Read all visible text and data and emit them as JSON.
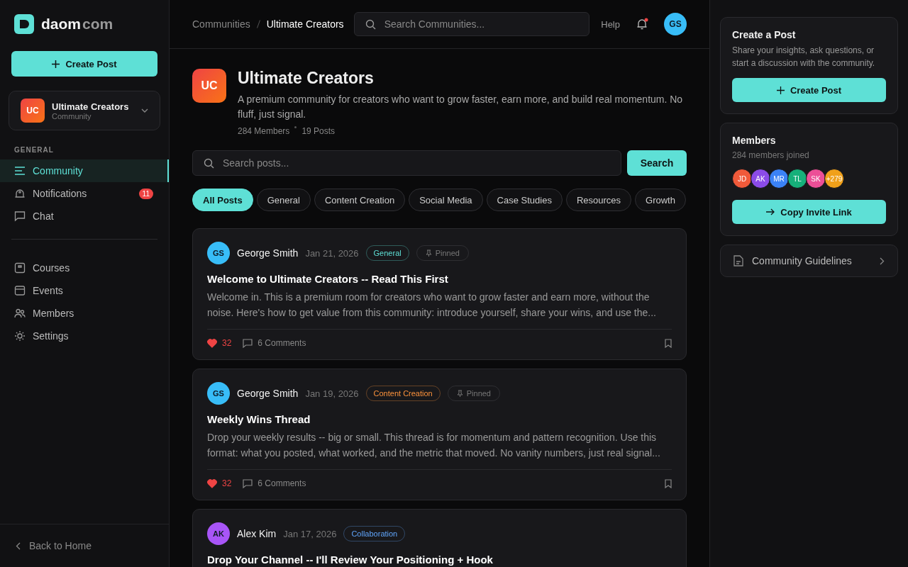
{
  "brand": {
    "name": "daom",
    "suffix": "com"
  },
  "sidebar": {
    "create_button": "Create Post",
    "community": {
      "initials": "UC",
      "name": "Ultimate Creators",
      "type": "Community"
    },
    "section_label": "GENERAL",
    "nav": [
      {
        "label": "Community",
        "kind": "list",
        "selected": true
      },
      {
        "label": "Notifications",
        "kind": "bell",
        "selected": false,
        "badge": "11"
      },
      {
        "label": "Chat",
        "kind": "chat",
        "selected": false
      }
    ],
    "nav2": [
      {
        "label": "Courses",
        "kind": "book",
        "selected": false
      },
      {
        "label": "Events",
        "kind": "calendar",
        "selected": false
      },
      {
        "label": "Members",
        "kind": "people",
        "selected": false
      },
      {
        "label": "Settings",
        "kind": "gear",
        "selected": false
      }
    ],
    "back": "Back to Home"
  },
  "topbar": {
    "breadcrumbs": [
      "Communities",
      "Ultimate Creators"
    ],
    "search_placeholder": "Search Communities...",
    "help": "Help",
    "notification_dot": true,
    "avatar": "GS"
  },
  "header": {
    "initials": "UC",
    "title": "Ultimate Creators",
    "description": "A premium community for creators who want to grow faster, earn more, and build real momentum. No fluff, just signal.",
    "members": "284 Members",
    "posts": "19 Posts"
  },
  "post_search": {
    "placeholder": "Search posts...",
    "button": "Search"
  },
  "filters": [
    {
      "label": "All Posts",
      "selected": true
    },
    {
      "label": "General",
      "selected": false
    },
    {
      "label": "Content Creation",
      "selected": false
    },
    {
      "label": "Social Media",
      "selected": false
    },
    {
      "label": "Case Studies",
      "selected": false
    },
    {
      "label": "Resources",
      "selected": false
    },
    {
      "label": "Growth",
      "selected": false
    }
  ],
  "posts": [
    {
      "avatar": {
        "initials": "GS",
        "color": "#38bdf8"
      },
      "author": "George Smith",
      "date": "Jan 21, 2026",
      "tag": {
        "label": "General",
        "color": "#5ee0d6"
      },
      "pinned": true,
      "pinned_label": "Pinned",
      "title": "Welcome to Ultimate Creators -- Read This First",
      "excerpt": "Welcome in. This is a premium room for creators who want to grow faster and earn more, without the noise. Here's how to get value from this community: introduce yourself, share your wins, and use the...",
      "liked": true,
      "likes": "32",
      "comments": "6 Comments"
    },
    {
      "avatar": {
        "initials": "GS",
        "color": "#38bdf8"
      },
      "author": "George Smith",
      "date": "Jan 19, 2026",
      "tag": {
        "label": "Content Creation",
        "color": "#fb923c"
      },
      "pinned": true,
      "pinned_label": "Pinned",
      "title": "Weekly Wins Thread",
      "excerpt": "Drop your weekly results -- big or small. This thread is for momentum and pattern recognition. Use this format: what you posted, what worked, and the metric that moved. No vanity numbers, just real signal...",
      "liked": true,
      "likes": "32",
      "comments": "6 Comments"
    },
    {
      "avatar": {
        "initials": "AK",
        "color": "#a855f7"
      },
      "author": "Alex Kim",
      "date": "Jan 17, 2026",
      "tag": {
        "label": "Collaboration",
        "color": "#60a5fa"
      },
      "pinned": false,
      "title": "Drop Your Channel -- I'll Review Your Positioning + Hook"
    }
  ],
  "right": {
    "create": {
      "title": "Create a Post",
      "text": "Share your insights, ask questions, or start a discussion with the community.",
      "button": "Create Post"
    },
    "members": {
      "title": "Members",
      "subtitle": "284 members joined",
      "avatars": [
        {
          "initials": "JD",
          "color": "#f05a3a"
        },
        {
          "initials": "AK",
          "color": "#8b4be8"
        },
        {
          "initials": "MR",
          "color": "#3b82f6"
        },
        {
          "initials": "TL",
          "color": "#16b07a"
        },
        {
          "initials": "SK",
          "color": "#ec4f97"
        },
        {
          "initials": "+279",
          "color": "#f0a01a"
        }
      ],
      "button": "Copy Invite Link"
    },
    "guidelines": "Community Guidelines"
  }
}
